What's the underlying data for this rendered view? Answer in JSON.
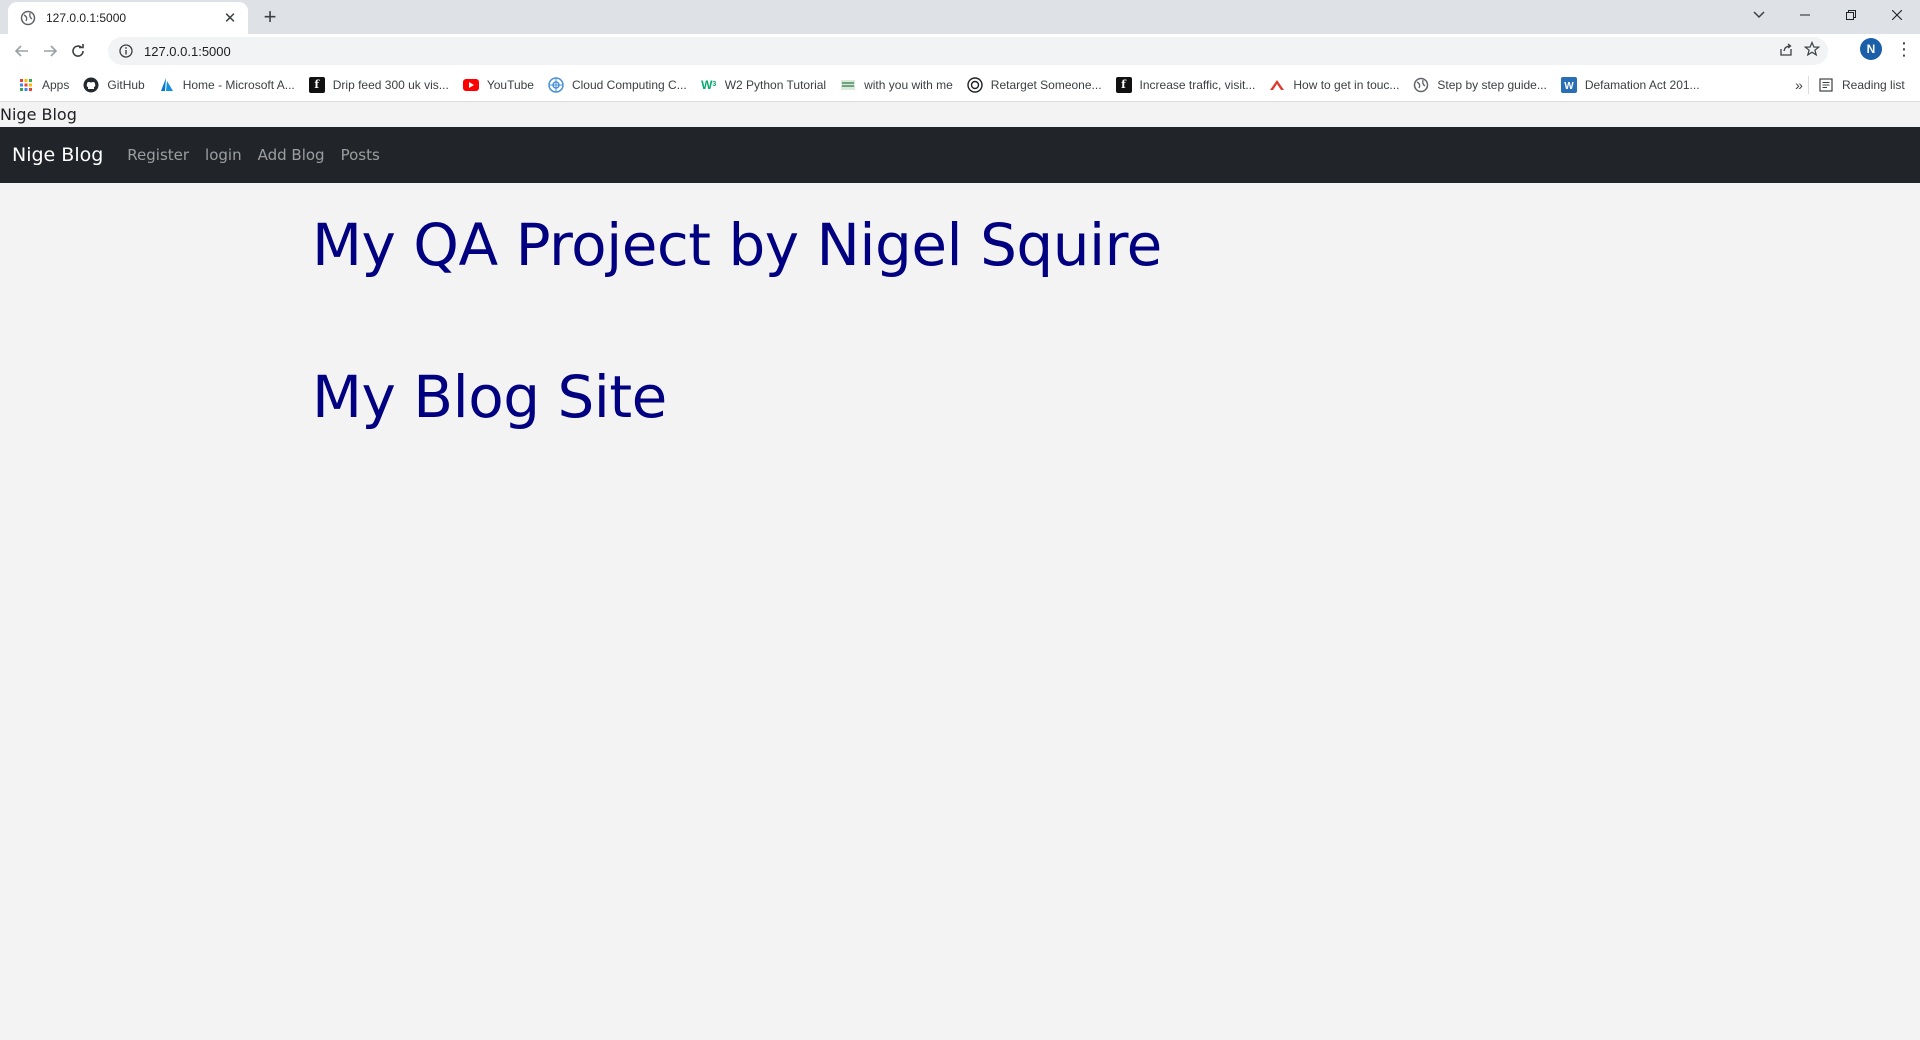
{
  "browser": {
    "tab_title": "127.0.0.1:5000",
    "url": "127.0.0.1:5000",
    "profile_initial": "N",
    "bookmarks": [
      {
        "label": "Apps",
        "icon": "apps-grid-icon"
      },
      {
        "label": "GitHub",
        "icon": "github-icon"
      },
      {
        "label": "Home - Microsoft A...",
        "icon": "azure-icon"
      },
      {
        "label": "Drip feed 300 uk vis...",
        "icon": "facebook-icon"
      },
      {
        "label": "YouTube",
        "icon": "youtube-icon"
      },
      {
        "label": "Cloud Computing C...",
        "icon": "cloud-icon"
      },
      {
        "label": "W2 Python Tutorial",
        "icon": "w3-icon"
      },
      {
        "label": "with you with me",
        "icon": "site-icon"
      },
      {
        "label": "Retarget Someone...",
        "icon": "target-icon"
      },
      {
        "label": "Increase traffic, visit...",
        "icon": "facebook-icon"
      },
      {
        "label": "How to get in touc...",
        "icon": "red-arrow-icon"
      },
      {
        "label": "Step by step guide...",
        "icon": "globe-icon"
      },
      {
        "label": "Defamation Act 201...",
        "icon": "wordpress-icon"
      }
    ],
    "reading_list": "Reading list"
  },
  "page": {
    "plain_title": "Nige Blog",
    "navbar": {
      "brand": "Nige Blog",
      "links": [
        "Register",
        "login",
        "Add Blog",
        "Posts"
      ]
    },
    "heading1": "My QA Project by Nigel Squire",
    "heading2": "My Blog Site"
  },
  "colors": {
    "navbar_bg": "#212529",
    "heading": "#000080",
    "page_bg": "#f3f3f3"
  }
}
